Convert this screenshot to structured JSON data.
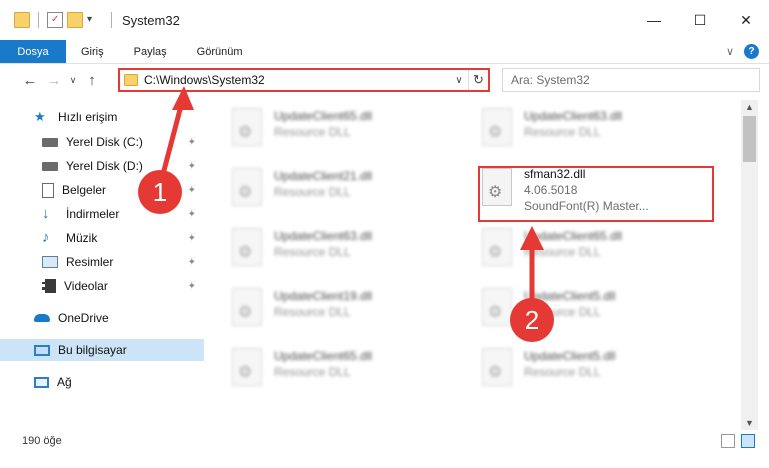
{
  "window": {
    "title": "System32",
    "minimize_glyph": "—",
    "maximize_glyph": "☐",
    "close_glyph": "✕"
  },
  "ribbon": {
    "tabs": [
      {
        "label": "Dosya",
        "active": true
      },
      {
        "label": "Giriş"
      },
      {
        "label": "Paylaş"
      },
      {
        "label": "Görünüm"
      }
    ],
    "expand_glyph": "∨",
    "help_glyph": "?"
  },
  "nav": {
    "back_glyph": "←",
    "forward_glyph": "→",
    "recent_glyph": "∨",
    "up_glyph": "↑",
    "address": "C:\\Windows\\System32",
    "address_dropdown_glyph": "∨",
    "refresh_glyph": "↻",
    "search_placeholder": "Ara: System32"
  },
  "sidebar": {
    "items": [
      {
        "label": "Hızlı erişim",
        "icon": "star-icon",
        "pinned": false
      },
      {
        "label": "Yerel Disk (C:)",
        "icon": "drive-icon",
        "pinned": true
      },
      {
        "label": "Yerel Disk (D:)",
        "icon": "drive-icon",
        "pinned": true
      },
      {
        "label": "Belgeler",
        "icon": "documents-icon",
        "pinned": true
      },
      {
        "label": "İndirmeler",
        "icon": "download-icon",
        "pinned": true
      },
      {
        "label": "Müzik",
        "icon": "music-icon",
        "pinned": true
      },
      {
        "label": "Resimler",
        "icon": "pictures-icon",
        "pinned": true
      },
      {
        "label": "Videolar",
        "icon": "video-icon",
        "pinned": true
      },
      {
        "label": "OneDrive",
        "icon": "cloud-icon",
        "pinned": false
      },
      {
        "label": "Bu bilgisayar",
        "icon": "computer-icon",
        "pinned": false,
        "selected": true
      },
      {
        "label": "Ağ",
        "icon": "network-icon",
        "pinned": false
      }
    ],
    "pin_glyph": "📌"
  },
  "files": [
    {
      "name": "UpdateClient65.dll",
      "sub": "Resource DLL",
      "blurred": true
    },
    {
      "name": "UpdateClient63.dll",
      "sub": "Resource DLL",
      "blurred": true
    },
    {
      "name": "UpdateClient21.dll",
      "sub": "Resource DLL",
      "blurred": true
    },
    {
      "name": "sfman32.dll",
      "version": "4.06.5018",
      "sub": "SoundFont(R) Master...",
      "blurred": false
    },
    {
      "name": "UpdateClient63.dll",
      "sub": "Resource DLL",
      "blurred": true
    },
    {
      "name": "UpdateClient65.dll",
      "sub": "Resource DLL",
      "blurred": true
    },
    {
      "name": "UpdateClient19.dll",
      "sub": "Resource DLL",
      "blurred": true
    },
    {
      "name": "UpdateClient5.dll",
      "sub": "Resource DLL",
      "blurred": true
    },
    {
      "name": "UpdateClient65.dll",
      "sub": "Resource DLL",
      "blurred": true
    },
    {
      "name": "UpdateClient5.dll",
      "sub": "Resource DLL",
      "blurred": true
    }
  ],
  "status": {
    "item_count": "190 öğe"
  },
  "annotations": {
    "step1": "1",
    "step2": "2",
    "color": "#e53935"
  },
  "colors": {
    "accent": "#1979ca",
    "selected_bg": "#cce4f7"
  }
}
